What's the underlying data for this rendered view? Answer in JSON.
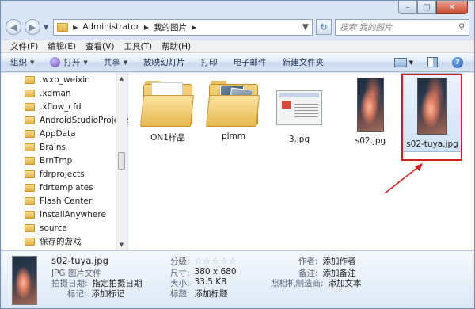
{
  "window": {
    "caption_min": "–",
    "caption_max": "□",
    "caption_close": "✕"
  },
  "address": {
    "back": "◀",
    "forward": "▶",
    "crumbs": [
      "Administrator",
      "我的图片"
    ],
    "search_placeholder": "搜索 我的图片"
  },
  "menu": [
    "文件(F)",
    "编辑(E)",
    "查看(V)",
    "工具(T)",
    "帮助(H)"
  ],
  "commands": {
    "organize": "组织",
    "open": "打开",
    "share": "共享",
    "slideshow": "放映幻灯片",
    "print": "打印",
    "email": "电子邮件",
    "new_folder": "新建文件夹",
    "help": "?"
  },
  "nav_items": [
    ".wxb_weixin",
    ".xdman",
    ".xflow_cfd",
    "AndroidStudioProjects",
    "AppData",
    "Brains",
    "BrnTmp",
    "fdrprojects",
    "fdrtemplates",
    "Flash Center",
    "InstallAnywhere",
    "source",
    "保存的游戏"
  ],
  "files": [
    {
      "name": "ON1样品",
      "icon": "folder-icon"
    },
    {
      "name": "plmm",
      "icon": "photo-folder-icon"
    },
    {
      "name": "3.jpg",
      "icon": "screenshot-thumbnail"
    },
    {
      "name": "s02.jpg",
      "icon": "image-thumbnail"
    },
    {
      "name": "s02-tuya.jpg",
      "icon": "image-thumbnail"
    }
  ],
  "selected_file": "s02-tuya.jpg",
  "details": {
    "filename": "s02-tuya.jpg",
    "filetype": "JPG 图片文件",
    "date_label": "拍摄日期:",
    "date_value": "指定拍摄日期",
    "tags_label": "标记:",
    "tags_value": "添加标记",
    "rating_label": "分级:",
    "rating": 0,
    "dims_label": "尺寸:",
    "dims_value": "380 x 680",
    "size_label": "大小:",
    "size_value": "33.5 KB",
    "title_label": "标题:",
    "title_value": "添加标题",
    "author_label": "作者:",
    "author_value": "添加作者",
    "comment_label": "备注:",
    "comment_value": "添加备注",
    "camera_label": "照相机制造商:",
    "camera_value": "添加文本"
  },
  "colors": {
    "highlight": "#d01d1d",
    "selection": "#cfe3f8"
  }
}
